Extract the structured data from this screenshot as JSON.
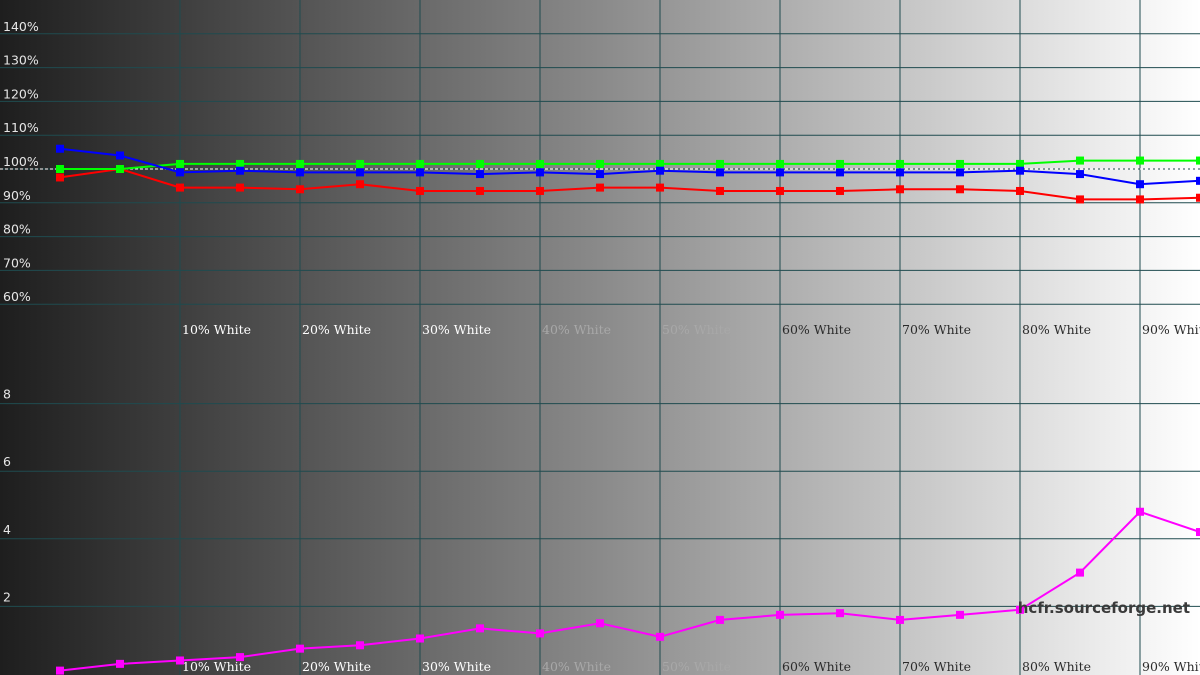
{
  "watermark": "hcfr.sourceforge.net",
  "colors": {
    "grid": "#1f4b4f",
    "reference": "#ffffff",
    "red": "#ff0000",
    "green": "#00ff00",
    "blue": "#0000ff",
    "magenta": "#ff00ff"
  },
  "chart_data": [
    {
      "type": "line",
      "title": "",
      "x": [
        0,
        5,
        10,
        15,
        20,
        25,
        30,
        35,
        40,
        45,
        50,
        55,
        60,
        65,
        70,
        75,
        80,
        85,
        90,
        95,
        100
      ],
      "x_tick_labels": [
        "10% White",
        "20% White",
        "30% White",
        "40% White",
        "50% White",
        "60% White",
        "70% White",
        "80% White",
        "90% White"
      ],
      "y_tick_labels": [
        "60%",
        "70%",
        "80%",
        "90%",
        "100%",
        "110%",
        "120%",
        "130%",
        "140%"
      ],
      "ylim": [
        55,
        145
      ],
      "reference_line": 100,
      "grid": true,
      "series": [
        {
          "color": "red",
          "values": [
            97.5,
            100,
            94.5,
            94.5,
            94,
            95.5,
            93.5,
            93.5,
            93.5,
            94.5,
            94.5,
            93.5,
            93.5,
            93.5,
            94,
            94,
            93.5,
            91,
            91,
            91.5
          ]
        },
        {
          "color": "green",
          "values": [
            100,
            100,
            101.5,
            101.5,
            101.5,
            101.5,
            101.5,
            101.5,
            101.5,
            101.5,
            101.5,
            101.5,
            101.5,
            101.5,
            101.5,
            101.5,
            101.5,
            102.5,
            102.5,
            102.5
          ]
        },
        {
          "color": "blue",
          "values": [
            106,
            104,
            99,
            99.5,
            99,
            99,
            99,
            98.5,
            99,
            98.5,
            99.5,
            99,
            99,
            99,
            99,
            99,
            99.5,
            98.5,
            95.5,
            96.5
          ]
        }
      ]
    },
    {
      "type": "line",
      "title": "",
      "x": [
        0,
        5,
        10,
        15,
        20,
        25,
        30,
        35,
        40,
        45,
        50,
        55,
        60,
        65,
        70,
        75,
        80,
        85,
        90,
        95,
        100
      ],
      "x_tick_labels": [
        "10% White",
        "20% White",
        "30% White",
        "40% White",
        "50% White",
        "60% White",
        "70% White",
        "80% White",
        "90% White"
      ],
      "y_tick_labels": [
        "2",
        "4",
        "6",
        "8"
      ],
      "ylim": [
        0,
        10
      ],
      "grid": true,
      "series": [
        {
          "color": "magenta",
          "values": [
            0.1,
            0.3,
            0.4,
            0.5,
            0.75,
            0.85,
            1.05,
            1.35,
            1.2,
            1.5,
            1.1,
            1.6,
            1.75,
            1.8,
            1.6,
            1.75,
            1.9,
            3.0,
            4.8,
            4.2
          ]
        }
      ]
    }
  ]
}
